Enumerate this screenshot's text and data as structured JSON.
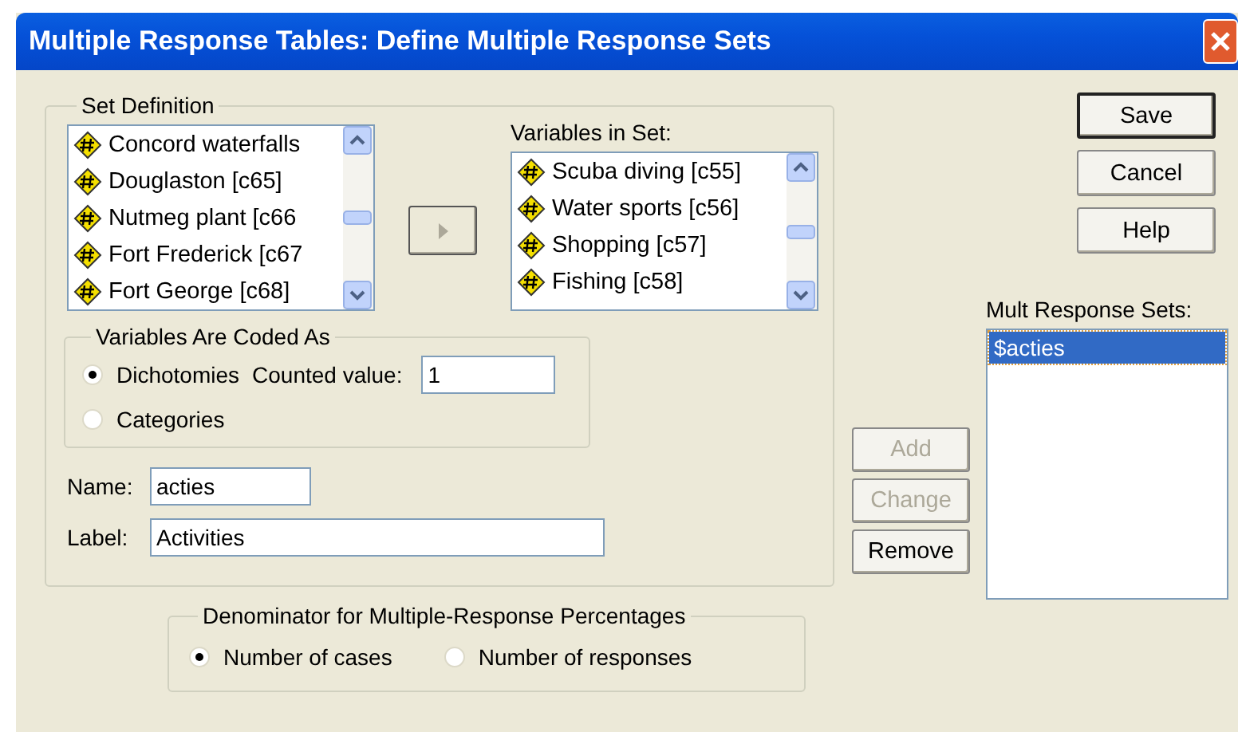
{
  "window": {
    "title": "Multiple Response Tables: Define Multiple Response Sets"
  },
  "set_definition": {
    "title": "Set Definition",
    "variables": [
      {
        "text": "Concord waterfalls"
      },
      {
        "text": "Douglaston [c65]"
      },
      {
        "text": "Nutmeg plant [c66"
      },
      {
        "text": "Fort Frederick [c67"
      },
      {
        "text": "Fort George  [c68]"
      }
    ],
    "move_button": {
      "disabled": true
    },
    "variables_in_set": {
      "label": "Variables in Set:",
      "items": [
        {
          "text": "Scuba diving [c55]"
        },
        {
          "text": "Water sports [c56]"
        },
        {
          "text": "Shopping [c57]"
        },
        {
          "text": "Fishing [c58]"
        }
      ]
    },
    "coded_as": {
      "title": "Variables Are Coded As",
      "options": [
        {
          "label": "Dichotomies",
          "selected": true
        },
        {
          "label": "Categories",
          "selected": false
        }
      ],
      "counted_value": {
        "label": "Counted value:",
        "value": "1"
      }
    },
    "name": {
      "label": "Name:",
      "value": "acties"
    },
    "label": {
      "label": "Label:",
      "value": "Activities"
    }
  },
  "denominator": {
    "title": "Denominator for Multiple-Response Percentages",
    "options": [
      {
        "label": "Number of cases",
        "selected": true
      },
      {
        "label": "Number of responses",
        "selected": false
      }
    ]
  },
  "set_actions": [
    {
      "label": "Add",
      "disabled": true
    },
    {
      "label": "Change",
      "disabled": true
    },
    {
      "label": "Remove",
      "disabled": false
    }
  ],
  "buttons": [
    {
      "label": "Save",
      "default": true
    },
    {
      "label": "Cancel",
      "default": false
    },
    {
      "label": "Help",
      "default": false
    }
  ],
  "mult_response_sets": {
    "label": "Mult Response Sets:",
    "items": [
      {
        "text": "$acties",
        "selected": true
      }
    ]
  }
}
